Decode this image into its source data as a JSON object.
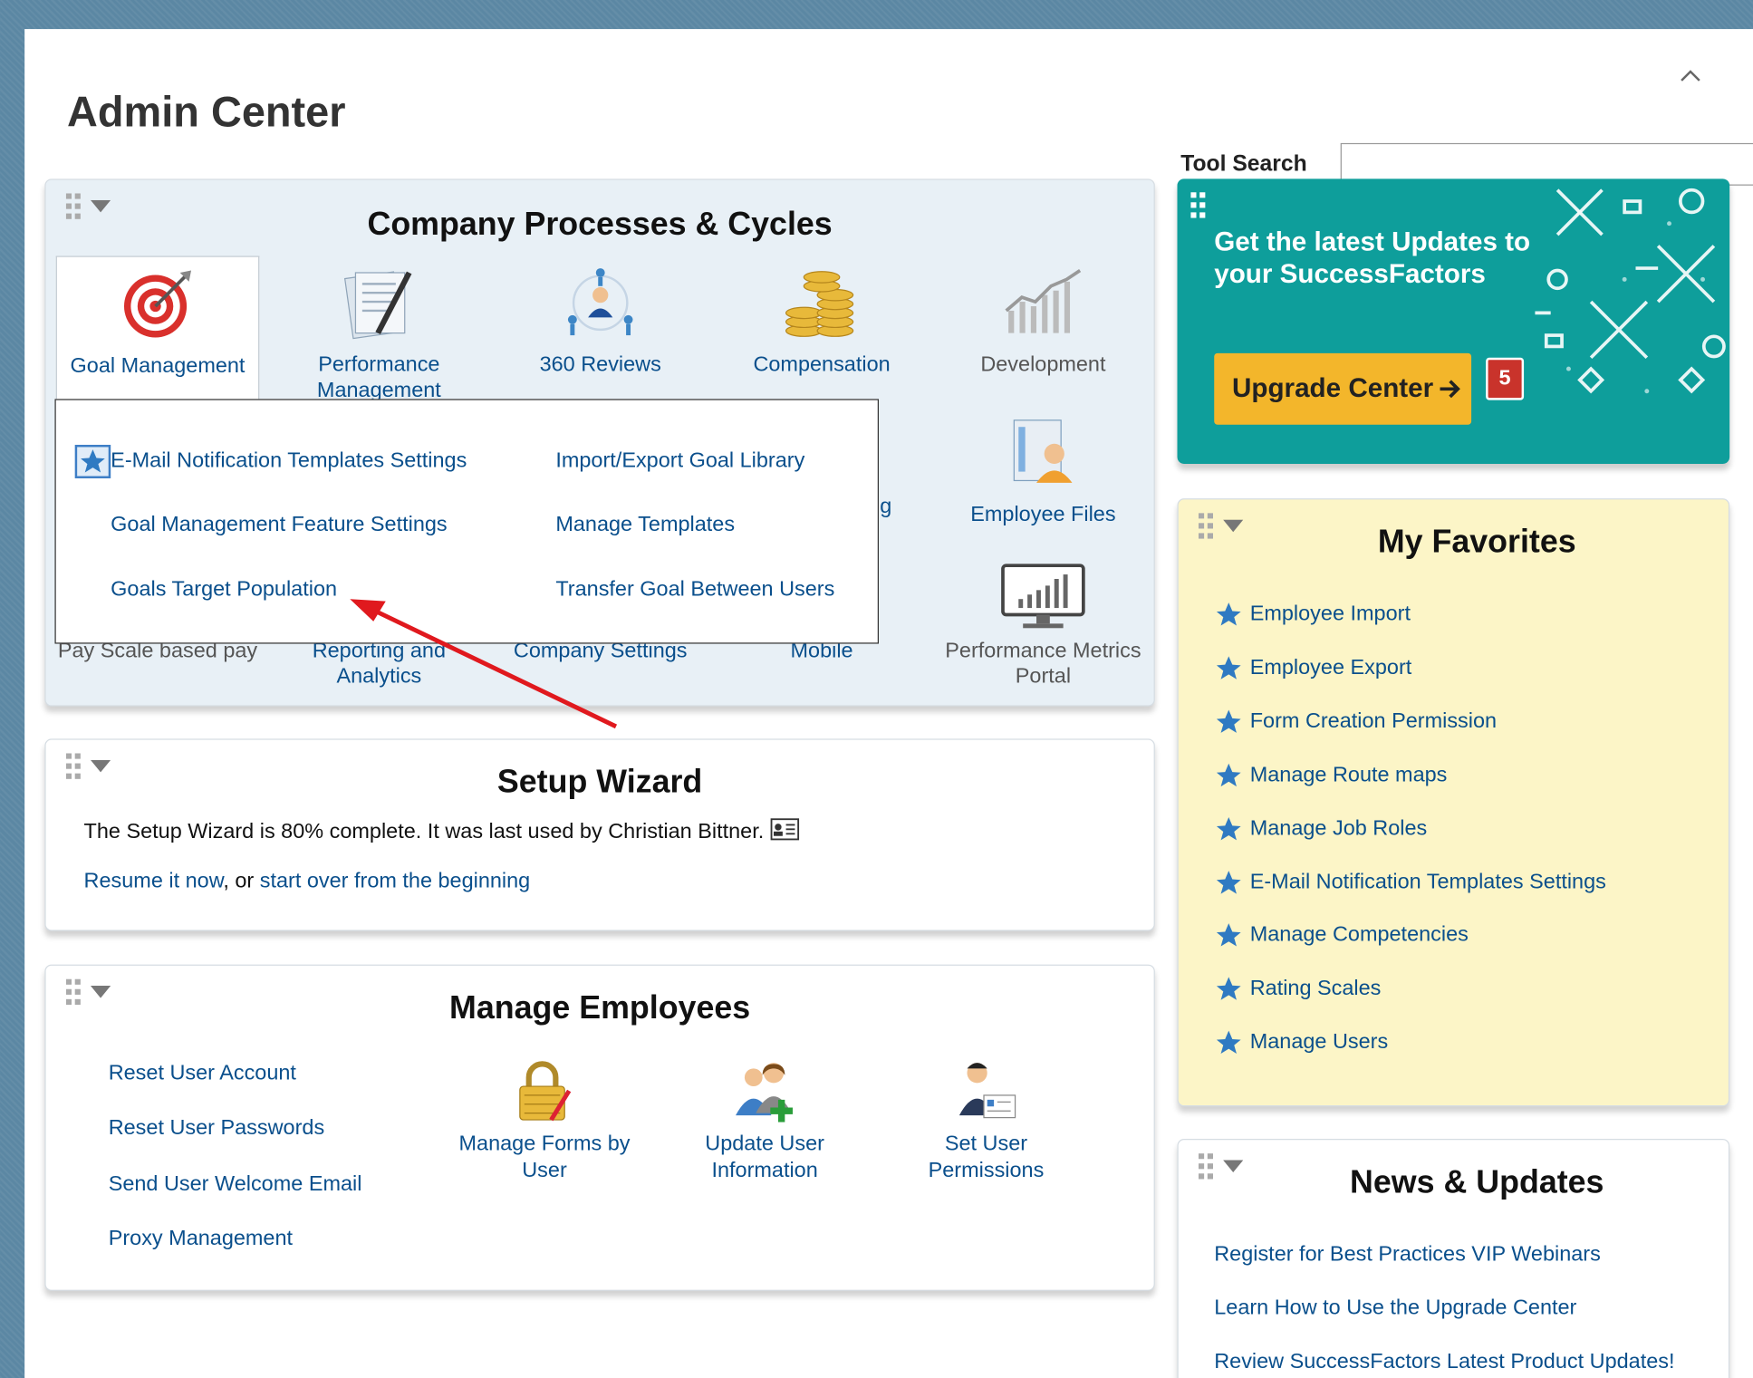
{
  "page": {
    "title": "Admin Center"
  },
  "tool_search": {
    "label": "Tool Search",
    "value": ""
  },
  "company_processes": {
    "title": "Company Processes & Cycles",
    "items": [
      {
        "label": "Goal Management",
        "icon": "target-icon"
      },
      {
        "label": "Performance Management",
        "icon": "document-pen-icon"
      },
      {
        "label": "360 Reviews",
        "icon": "people-network-icon"
      },
      {
        "label": "Compensation",
        "icon": "coins-icon"
      },
      {
        "label": "Development",
        "icon": "chart-arrow-icon"
      },
      {
        "label": "Employee Files",
        "icon": "employee-file-icon"
      },
      {
        "label": "Pay Scale based pay",
        "icon": ""
      },
      {
        "label": "Reporting and Analytics",
        "icon": ""
      },
      {
        "label": "Company Settings",
        "icon": ""
      },
      {
        "label": "Mobile",
        "icon": ""
      },
      {
        "label": "Performance Metrics Portal",
        "icon": "monitor-chart-icon"
      }
    ],
    "partial_label": "g",
    "popup": {
      "left": [
        "E-Mail Notification Templates Settings",
        "Goal Management Feature Settings",
        "Goals Target Population"
      ],
      "right": [
        "Import/Export Goal Library",
        "Manage Templates",
        "Transfer Goal Between Users"
      ]
    }
  },
  "setup_wizard": {
    "title": "Setup Wizard",
    "status": "The Setup Wizard is 80% complete. It was last used by Christian Bittner.",
    "resume_link": "Resume it now",
    "separator": ", or ",
    "restart_link": "start over from the beginning"
  },
  "manage_employees": {
    "title": "Manage Employees",
    "links": [
      "Reset User Account",
      "Reset User Passwords",
      "Send User Welcome Email",
      "Proxy Management"
    ],
    "icons": [
      {
        "label": "Manage Forms by User",
        "icon": "lock-form-icon"
      },
      {
        "label": "Update User Information",
        "icon": "users-add-icon"
      },
      {
        "label": "Set User Permissions",
        "icon": "user-card-icon"
      }
    ]
  },
  "upgrade": {
    "text": "Get the latest Updates to your SuccessFactors",
    "button": "Upgrade Center",
    "badge": "5"
  },
  "favorites": {
    "title": "My Favorites",
    "items": [
      "Employee Import",
      "Employee Export",
      "Form Creation Permission",
      "Manage Route maps",
      "Manage Job Roles",
      "E-Mail Notification Templates Settings",
      "Manage Competencies",
      "Rating Scales",
      "Manage Users"
    ]
  },
  "news": {
    "title": "News & Updates",
    "items": [
      "Register for Best Practices VIP Webinars",
      "Learn How to Use the Upgrade Center",
      "Review SuccessFactors Latest Product Updates!"
    ]
  },
  "colors": {
    "link": "#0a4f8c",
    "upgrade_bg": "#0e9e9b",
    "upgrade_button": "#f3b62b",
    "favorites_bg": "#fcf5c7",
    "badge": "#c9332b",
    "annotation_arrow": "#e0191e"
  }
}
